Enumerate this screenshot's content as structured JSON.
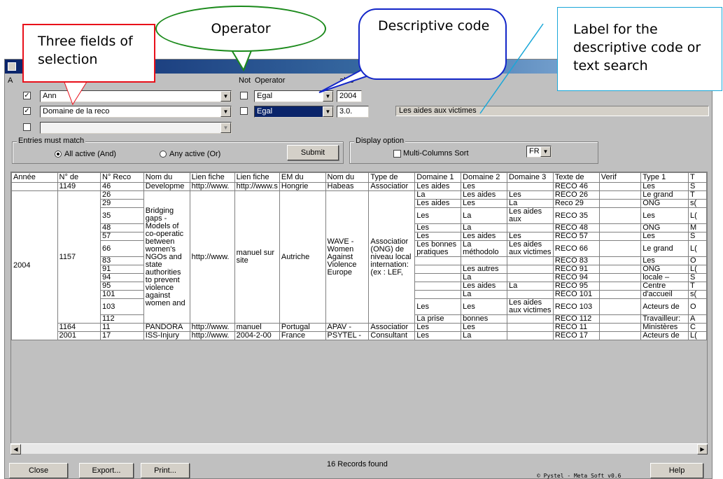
{
  "annotations": {
    "fields_callout": "Three fields of selection",
    "operator_callout": "Operator",
    "code_callout": "Descriptive code",
    "label_callout": "Label for the descriptive code or text search"
  },
  "form": {
    "headers": {
      "a": "A",
      "not": "Not",
      "operator": "Operator",
      "value": "alue"
    },
    "rows": [
      {
        "checked": "✓",
        "field": "Ann",
        "not": "",
        "operator": "Egal",
        "value": "2004",
        "label": ""
      },
      {
        "checked": "✓",
        "field": "Domaine de la reco",
        "not": "",
        "operator": "Egal",
        "value": "3.0.",
        "label": "Les aides aux victimes"
      },
      {
        "checked": "",
        "field": "",
        "not": "",
        "operator": "",
        "value": "",
        "label": ""
      }
    ],
    "entries_group": {
      "title": "Entries must match",
      "all": "All active (And)",
      "any": "Any active (Or)"
    },
    "submit": "Submit",
    "display_group": {
      "title": "Display option",
      "multi_sort": "Multi-Columns Sort",
      "lang": "FR"
    }
  },
  "table": {
    "columns": [
      "Année",
      "N° de",
      "N° Reco",
      "Nom du",
      "Lien fiche",
      "Lien fiche",
      "EM du",
      "Nom du",
      "Type de",
      "Domaine 1",
      "Domaine 2",
      "Domaine 3",
      "Texte de",
      "Verif",
      "Type 1",
      "T"
    ],
    "r0": [
      "",
      "1149",
      "46",
      "Developme",
      "http://www.",
      "http://www.s",
      "Hongrie",
      "Habeas",
      "Associatior",
      "Les aides",
      "Les",
      "",
      "RECO 46",
      "",
      "Les",
      "S"
    ],
    "g": {
      "year": "2004",
      "num": "1157",
      "nom": "Bridging gaps - Models of co-operatic between women's NGOs and state authorities to prevent violence against women and",
      "lien1": "http://www.",
      "lien2": "manuel sur site",
      "em": "Autriche",
      "nomorg": "WAVE - Women Against Violence Europe",
      "type": "Associatior (ONG) de niveau local internation: (ex : LEF,",
      "reco": [
        "26",
        "29",
        "35",
        "48",
        "57",
        "66",
        "83",
        "91",
        "94",
        "95",
        "101",
        "103",
        "112"
      ],
      "dom1": [
        "La",
        "Les aides",
        "Les",
        "Les",
        "Les",
        "Les bonnes pratiques",
        "",
        "",
        "",
        "",
        "",
        "Les",
        "La prise"
      ],
      "dom2": [
        "Les aides",
        "Les",
        "La",
        "La",
        "Les aides",
        "La méthodolo",
        "",
        "Les autres",
        "La",
        "Les aides",
        "La",
        "Les",
        "bonnes"
      ],
      "dom3": [
        "Les",
        "La",
        "Les aides aux",
        "",
        "Les",
        "Les aides aux victimes",
        "",
        "",
        "",
        "La",
        "",
        "Les aides aux victimes",
        ""
      ],
      "texte": [
        "RECO 26",
        "Reco 29",
        "RECO 35",
        "RECO 48",
        "RECO 57",
        "RECO 66",
        "RECO 83",
        "RECO 91",
        "RECO 94",
        "RECO 95",
        "RECO 101",
        "RECO 103",
        "RECO 112"
      ],
      "type1": [
        "Le grand",
        "ONG",
        "Les",
        "ONG",
        "Les",
        "Le grand",
        "Les",
        "ONG",
        "locale –",
        "Centre",
        "d'accueil",
        "Acteurs de",
        "Travailleur:"
      ],
      "t": [
        "T",
        "s(",
        "L(",
        "M",
        "S",
        "L(",
        "O",
        "L(",
        "S",
        "T",
        "s(",
        "O",
        "A"
      ]
    },
    "r14": [
      "",
      "1164",
      "11",
      "PANDORA",
      "http://www.",
      "manuel",
      "Portugal",
      "APAV -",
      "Associatior",
      "Les",
      "Les",
      "",
      "RECO 11",
      "",
      "Ministères",
      "C"
    ],
    "r15": [
      "",
      "2001",
      "17",
      "ISS-Injury",
      "http://www.",
      "2004-2-00",
      "France",
      "PSYTEL -",
      "Consultant",
      "Les",
      "La",
      "",
      "RECO 17",
      "",
      "Acteurs de",
      "L("
    ]
  },
  "status": {
    "records": "16 Records found",
    "copyright": "© Pystel - Meta Soft v0.6"
  },
  "buttons": {
    "close": "Close",
    "export": "Export...",
    "print": "Print...",
    "help": "Help"
  },
  "colors": {
    "red_callout": "#e8101a",
    "green_callout": "#1b8a1b",
    "blue_callout": "#1326c8",
    "cyan_callout": "#1aa7d8",
    "title_bar": "#0a246a"
  }
}
